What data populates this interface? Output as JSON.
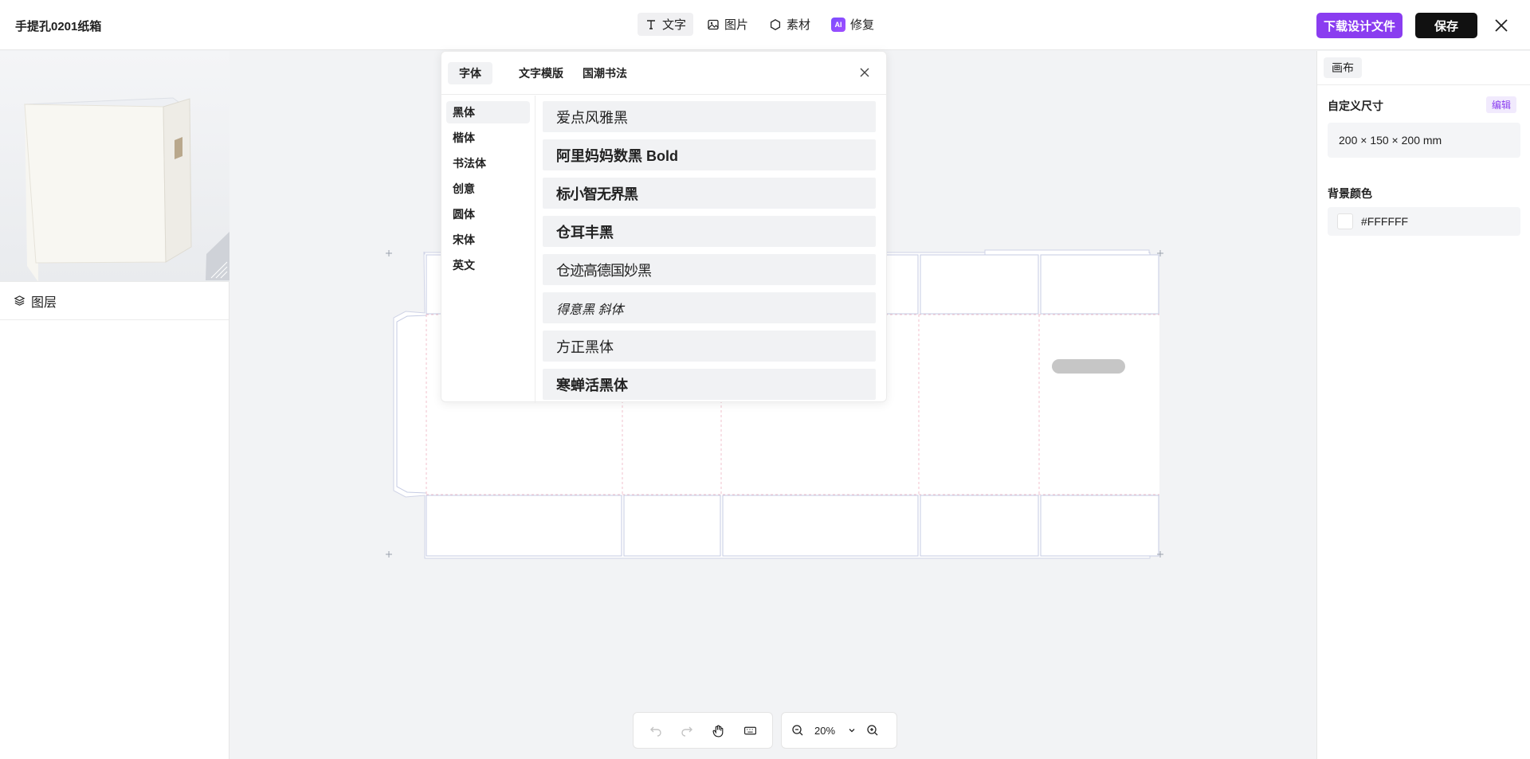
{
  "header": {
    "title": "手提孔0201纸箱",
    "tools": [
      {
        "label": "文字",
        "icon": "text-icon",
        "active": true
      },
      {
        "label": "图片",
        "icon": "image-icon",
        "active": false
      },
      {
        "label": "素材",
        "icon": "hexagon-icon",
        "active": false
      },
      {
        "label": "修复",
        "icon": "ai-icon",
        "badge": "AI",
        "active": false
      }
    ],
    "download_label": "下载设计文件",
    "save_label": "保存",
    "brand_color": "#8A3DF0"
  },
  "left_panel": {
    "layers_label": "图层"
  },
  "font_panel": {
    "tabs": [
      "字体",
      "文字模版",
      "国潮书法"
    ],
    "active_tab": 0,
    "categories": [
      "黑体",
      "楷体",
      "书法体",
      "创意",
      "圆体",
      "宋体",
      "英文"
    ],
    "active_category": 0,
    "fonts": [
      "爱点风雅黑",
      "阿里妈妈数黑 Bold",
      "标小智无界黑",
      "仓耳丰黑",
      "仓迹高德国妙黑",
      "得意黑 斜体",
      "方正黑体",
      "寒蝉活黑体"
    ]
  },
  "right_panel": {
    "tab_label": "画布",
    "size_label": "自定义尺寸",
    "edit_label": "编辑",
    "size_value": "200 × 150 × 200 mm",
    "bg_label": "背景颜色",
    "bg_value": "#FFFFFF"
  },
  "bottom": {
    "zoom": "20%"
  }
}
